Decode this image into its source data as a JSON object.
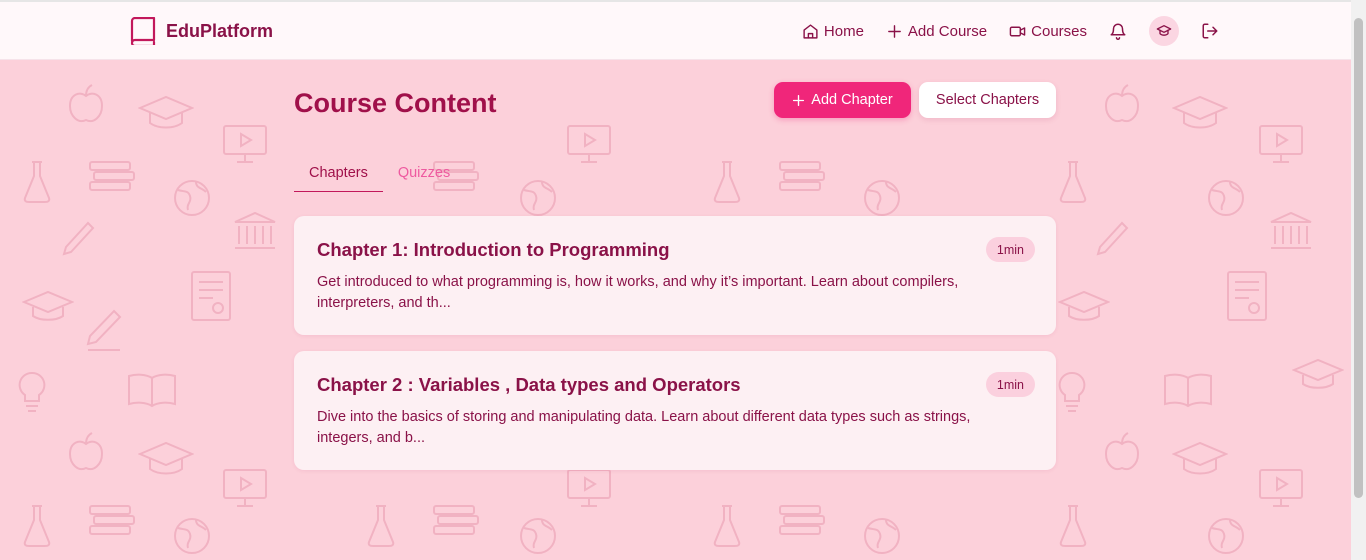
{
  "brand": {
    "name": "EduPlatform"
  },
  "nav": {
    "home_label": "Home",
    "add_course_label": "Add Course",
    "courses_label": "Courses"
  },
  "page": {
    "title": "Course Content",
    "add_chapter_label": "Add Chapter",
    "select_chapters_label": "Select Chapters"
  },
  "tabs": [
    {
      "label": "Chapters",
      "active": true
    },
    {
      "label": "Quizzes",
      "active": false
    }
  ],
  "chapters": [
    {
      "title": "Chapter 1: Introduction to Programming",
      "description": "Get introduced to what programming is, how it works, and why it’s important. Learn about compilers, interpreters, and th...",
      "duration": "1min"
    },
    {
      "title": "Chapter 2 : Variables , Data types and Operators",
      "description": "Dive into the basics of storing and manipulating data. Learn about different data types such as strings, integers, and b...",
      "duration": "1min"
    }
  ],
  "colors": {
    "primary": "#f0267a",
    "text": "#8a1248",
    "background": "#fcd0da",
    "card": "#fdf0f3"
  }
}
